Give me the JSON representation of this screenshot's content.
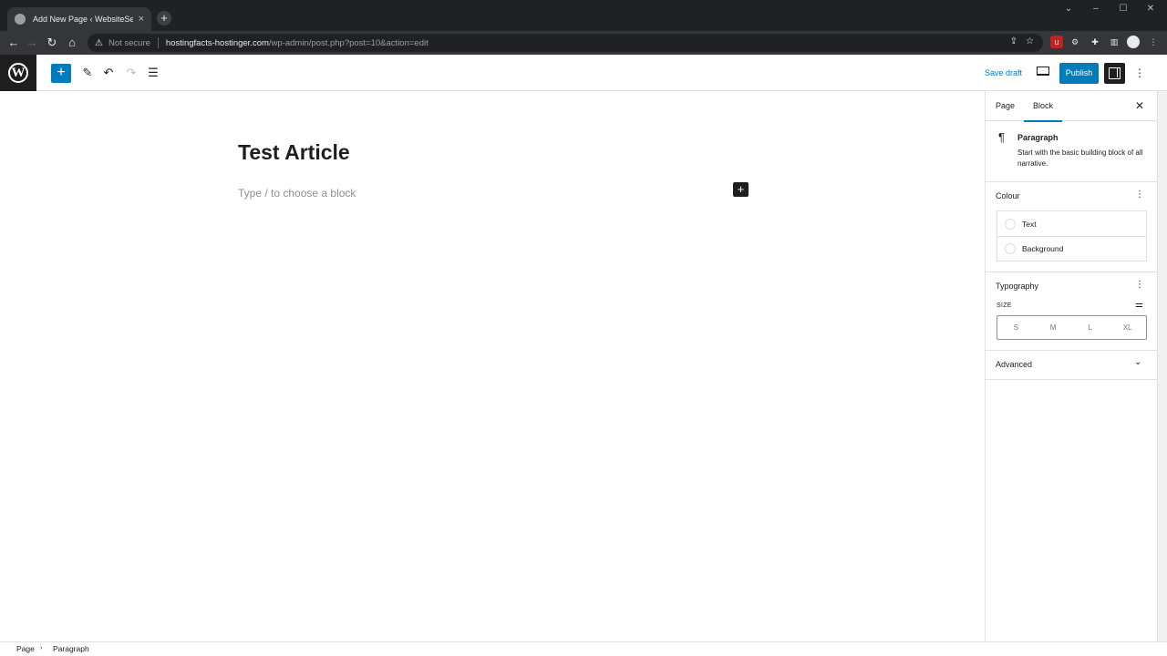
{
  "browser": {
    "tab_title": "Add New Page ‹ WebsiteSetup",
    "tab_close": "×",
    "new_tab": "+",
    "not_secure": "Not secure",
    "url_host": "hostingfacts-hostinger.com",
    "url_path": "/wp-admin/post.php?post=10&action=edit"
  },
  "toolbar": {
    "save_draft": "Save draft",
    "publish": "Publish"
  },
  "editor": {
    "title": "Test Article",
    "placeholder": "Type / to choose a block"
  },
  "sidebar": {
    "tabs": [
      "Page",
      "Block"
    ],
    "active_tab": "Block",
    "block_name": "Paragraph",
    "block_description": "Start with the basic building block of all narrative.",
    "colour_title": "Colour",
    "colour_items": [
      "Text",
      "Background"
    ],
    "typography_title": "Typography",
    "size_label": "SIZE",
    "size_options": [
      "S",
      "M",
      "L",
      "XL"
    ],
    "advanced_title": "Advanced"
  },
  "breadcrumb": [
    "Page",
    "Paragraph"
  ],
  "colors": {
    "accent": "#007cba",
    "dark": "#1e1e1e",
    "chrome_bg": "#202124"
  },
  "icons": [
    "wordpress-logo-icon",
    "plus-icon",
    "pencil-icon",
    "undo-icon",
    "redo-icon",
    "list-view-icon",
    "desktop-preview-icon",
    "settings-icon",
    "more-vertical-icon",
    "pilcrow-icon",
    "close-icon",
    "chevron-down-icon",
    "sliders-icon"
  ]
}
